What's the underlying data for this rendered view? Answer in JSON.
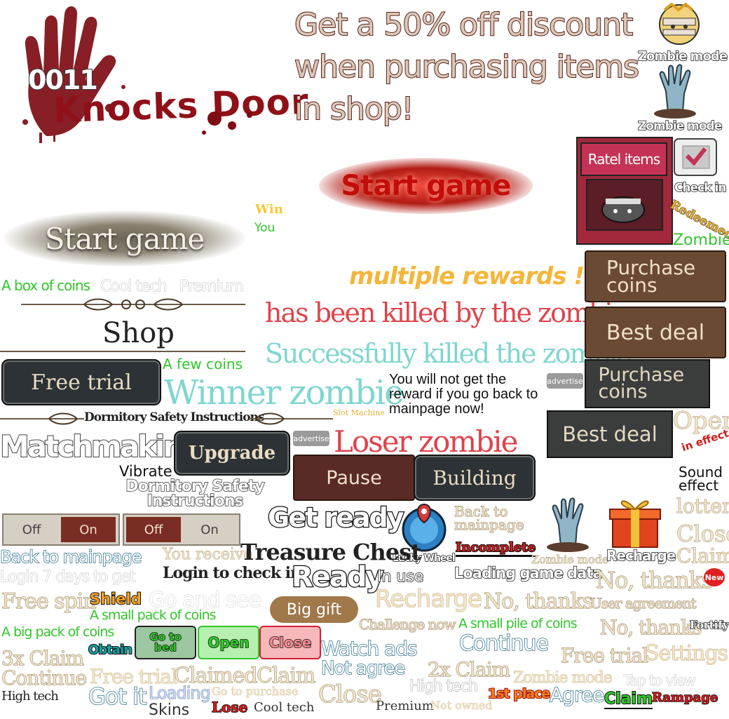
{
  "logo": {
    "line1": "0011",
    "line2": "Knocks Door"
  },
  "promo": {
    "line1": "Get a 50% off discount",
    "line2": "when purchasing items",
    "line3": "in shop!"
  },
  "side": {
    "zombie_mode_1": "Zombie mode",
    "zombie_mode_2": "Zombie mode",
    "ratel_items": "Ratel items",
    "check_in": "Check in",
    "redeemed": "Redeemed",
    "zombie": "Zombie"
  },
  "buttons": {
    "start_game_red": "Start game",
    "start_game_grey": "Start game",
    "purchase_coins_1": "Purchase coins",
    "best_deal_1": "Best deal",
    "purchase_coins_2": "Purchase coins",
    "best_deal_2": "Best deal",
    "free_trial": "Free trial",
    "upgrade": "Upgrade",
    "pause": "Pause",
    "building": "Building",
    "big_gift": "Big gift",
    "go_to_bed": "Go to bed",
    "open_green": "Open",
    "close_red": "Close",
    "toggle1_off": "Off",
    "toggle1_on": "On",
    "toggle2_off": "Off",
    "toggle2_on": "On"
  },
  "texts": {
    "win": "Win",
    "you": "You",
    "multiple_rewards": "multiple rewards !",
    "killed_by_zombie": "has been killed by the zombie",
    "killed_the_zombie": "Successfully killed the zombie",
    "box_of_coins": "A box of coins",
    "cool_tech": "Cool tech",
    "premium": "Premium",
    "shop": "Shop",
    "a_few_coins": "A few coins",
    "winner_zombie": "Winner zombie",
    "slot_machine": "Slot Machine",
    "back_warning": "You will not get the reward if you go back to mainpage now!",
    "advertise_1": "advertise",
    "advertise_2": "advertise",
    "dormitory_title": "Dormitory Safety Instructions",
    "matchmaking": "Matchmaking",
    "loser_zombie": "Loser zombie",
    "open_serif": "Open",
    "in_effect": "in effect",
    "vibrate": "Vibrate",
    "dormitory_outline": "Dormitory Safety Instructions",
    "sound_effect": "Sound effect",
    "lottery": "lottery",
    "get_ready": "Get ready",
    "back_to_mainpage_small": "Back to mainpage",
    "close_serif": "Close",
    "claim_serif": "Claim",
    "lucky_wheel": "Lucky Wheel",
    "incomplete": "Incomplete",
    "zombie_mode_3": "Zombie mode",
    "recharge_label": "Recharge",
    "back_to_mainpage": "Back to mainpage",
    "you_receive": "You receive",
    "treasure_chest": "Treasure Chest",
    "login_check": "Login to check in",
    "ready": "Ready",
    "in_use": "In use",
    "loading_data": "Loading game data",
    "no_thanks_1": "No, thanks",
    "new": "New",
    "login_7_days": "Login 7 days to get",
    "free_spin": "Free spin",
    "shield": "Shield",
    "go_and_see": "Go and see",
    "recharge_big": "Recharge",
    "no_thanks_2": "No, thanks",
    "user_agreement": "User agreement",
    "small_pack": "A small pack of coins",
    "challenge_now": "Challenge now",
    "small_pile": "A small pile of coins",
    "no_thanks_3": "No, thanks",
    "fortify": "Fortify",
    "big_pack": "A big pack of coins",
    "obtain": "Obtain",
    "watch_ads": "Watch ads",
    "continue_1": "Continue",
    "free_trial_2": "Free trial",
    "settings": "Settings",
    "claim_3x": "3x Claim",
    "not_agree": "Not agree",
    "claim_2x": "2x Claim",
    "continue_2": "Continue",
    "free_trial_3": "Free trial",
    "claimed": "Claimed",
    "claim_2": "Claim",
    "high_tech_1": "High tech",
    "zombie_mode_4": "Zombie mode",
    "tap_to_view": "Tap to view",
    "high_tech_2": "High tech",
    "got_it": "Got it",
    "loading": "Loading",
    "go_to_purchase": "Go to purchase",
    "close_2": "Close",
    "first_place": "1st place",
    "agree": "Agree",
    "claim_green": "Claim",
    "rampage": "Rampage",
    "skins": "Skins",
    "lose": "Lose",
    "cool_tech_2": "Cool tech",
    "premium_2": "Premium",
    "not_owned": "Not owned"
  },
  "colors": {
    "blood_red": "#8f1018",
    "promo_text": "#5e1f1a",
    "green_label": "#31c62a",
    "teal": "#7fd6cf",
    "killed_red": "#e0434b",
    "orange": "#f4b63a",
    "brown_btn": "#6b4a34",
    "dark_btn": "#2c3235"
  }
}
